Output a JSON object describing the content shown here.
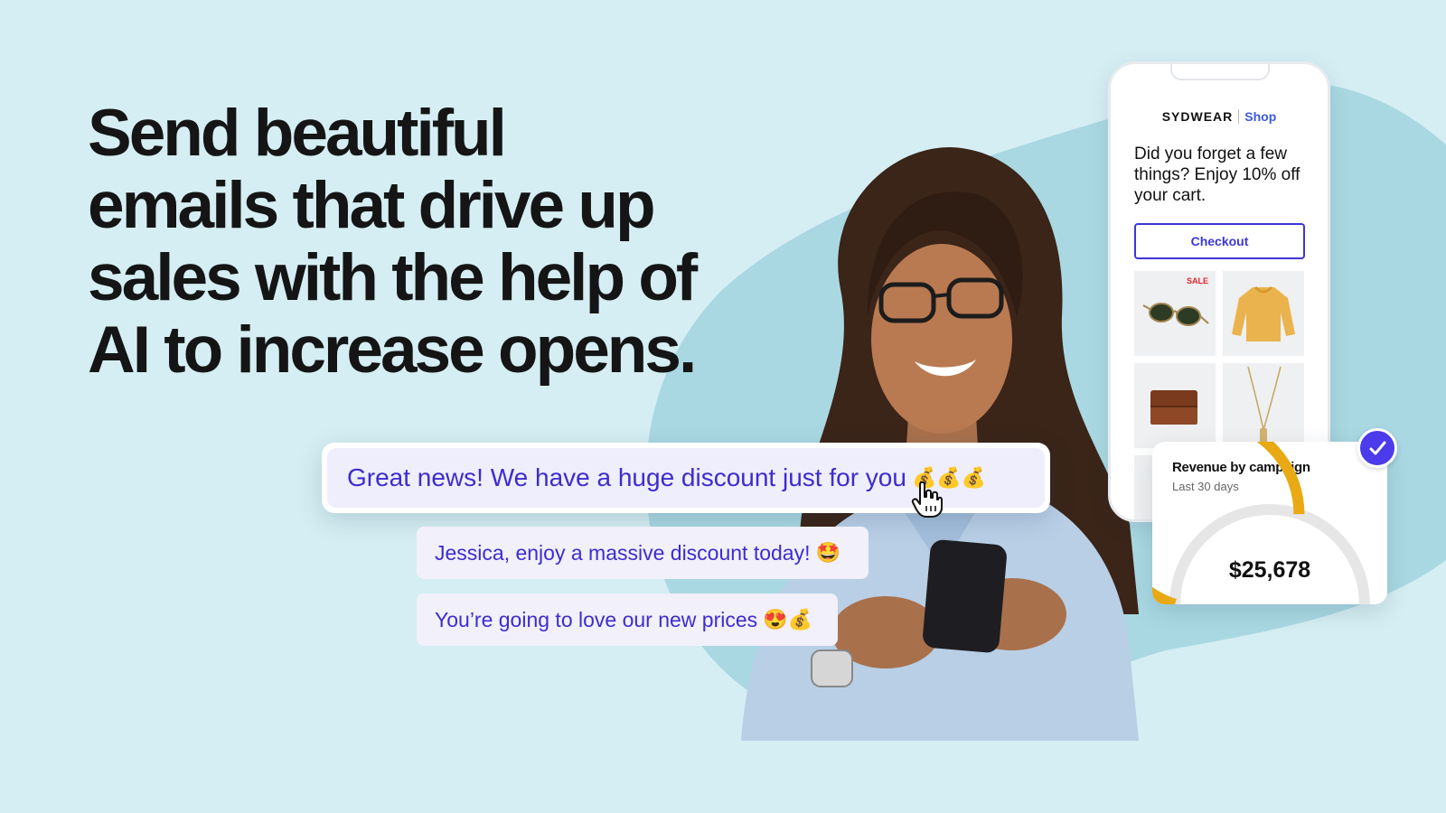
{
  "headline": {
    "line1": "Send beautiful",
    "line2": "emails that drive up",
    "line3": "sales with the help of",
    "line4": "AI to increase opens."
  },
  "suggestions": {
    "primary": "Great news! We have a huge discount just for you",
    "primary_emoji": "💰💰💰",
    "second": "Jessica, enjoy a massive discount today!",
    "second_emoji": "🤩",
    "third": "You’re going to love our new prices",
    "third_emoji": "😍💰"
  },
  "phone": {
    "brand": "SYDWEAR",
    "shop_label": "Shop",
    "message": "Did you forget a few things? Enjoy 10% off your cart.",
    "checkout_label": "Checkout",
    "sale_badge": "SALE",
    "products": [
      "sunglasses-icon",
      "sweater-icon",
      "wallet-icon",
      "necklace-icon"
    ]
  },
  "revenue_card": {
    "title": "Revenue by campaign",
    "subtitle": "Last 30 days",
    "value": "$25,678",
    "progress": 0.6
  },
  "colors": {
    "background": "#d5eef3",
    "blob": "#a9d8e2",
    "accent_purple": "#3d2ccf",
    "gauge_gold": "#e8a912",
    "badge": "#4b3bea"
  }
}
